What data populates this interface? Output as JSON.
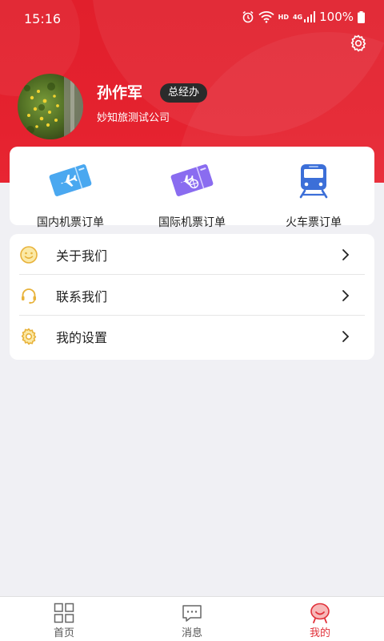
{
  "status_bar": {
    "time": "15:16",
    "battery": "100%",
    "network": "4G",
    "hd": "HD"
  },
  "profile": {
    "name": "孙作军",
    "role": "总经办",
    "company": "妙知旅测试公司"
  },
  "orders": [
    {
      "label": "国内机票订单",
      "icon": "domestic-flight-ticket-icon",
      "color": "#4aa8f0"
    },
    {
      "label": "国际机票订单",
      "icon": "international-flight-ticket-icon",
      "color": "#8a6cf0"
    },
    {
      "label": "火车票订单",
      "icon": "train-icon",
      "color": "#3c6fd8"
    }
  ],
  "menu": [
    {
      "label": "关于我们",
      "icon": "smile-icon"
    },
    {
      "label": "联系我们",
      "icon": "headset-icon"
    },
    {
      "label": "我的设置",
      "icon": "settings-icon"
    }
  ],
  "tabs": [
    {
      "label": "首页",
      "icon": "home-grid-icon"
    },
    {
      "label": "消息",
      "icon": "message-icon"
    },
    {
      "label": "我的",
      "icon": "profile-face-icon",
      "active": true
    }
  ],
  "colors": {
    "brand_red": "#e5222f",
    "accent_gold": "#e8b23a",
    "tab_active": "#e1313a"
  }
}
